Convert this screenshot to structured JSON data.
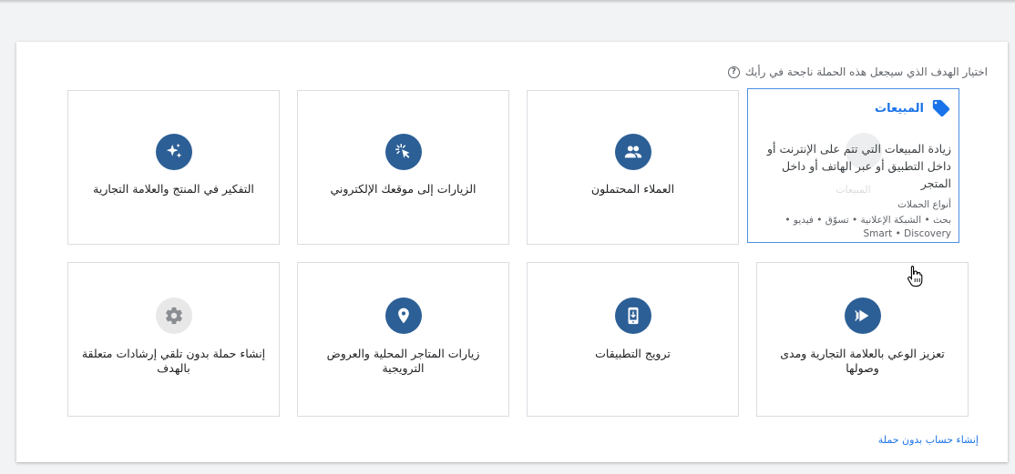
{
  "prompt": {
    "question": "اختيار الهدف الذي سيجعل هذه الحملة ناجحة في رأيك",
    "help_icon": "?"
  },
  "goals": {
    "sales": {
      "title": "المبيعات",
      "icon": "tag-icon",
      "description": "زيادة المبيعات التي تتم على الإنترنت أو داخل التطبيق أو عبر الهاتف أو داخل المتجر",
      "ghost_label": "المبيعات",
      "types_title": "أنواع الحملات",
      "types_list": "بحث • الشبكة الإعلانية • تسوّق • فيديو • Smart • Discovery",
      "selected": true
    },
    "leads": {
      "label": "العملاء المحتملون",
      "icon": "people-icon"
    },
    "website_traffic": {
      "label": "الزيارات إلى موقعك الإلكتروني",
      "icon": "cursor-click-icon"
    },
    "product_brand": {
      "label": "التفكير في المنتج والعلامة التجارية",
      "icon": "sparkle-icon"
    },
    "awareness": {
      "label": "تعزيز الوعي بالعلامة التجارية ومدى وصولها",
      "icon": "megaphone-icon"
    },
    "app_promotion": {
      "label": "ترويج التطبيقات",
      "icon": "mobile-download-icon"
    },
    "local_visits": {
      "label": "زيارات المتاجر المحلية والعروض الترويجية",
      "icon": "location-pin-icon"
    },
    "no_goal": {
      "label": "إنشاء حملة بدون تلقي إرشادات متعلقة بالهدف",
      "icon": "gear-icon"
    }
  },
  "footer": {
    "create_account_link": "إنشاء حساب بدون حملة"
  },
  "colors": {
    "accent": "#1a73e8",
    "icon_circle": "#2c5f96",
    "selected_border": "#4a90e2",
    "card_border": "#dadce0"
  }
}
